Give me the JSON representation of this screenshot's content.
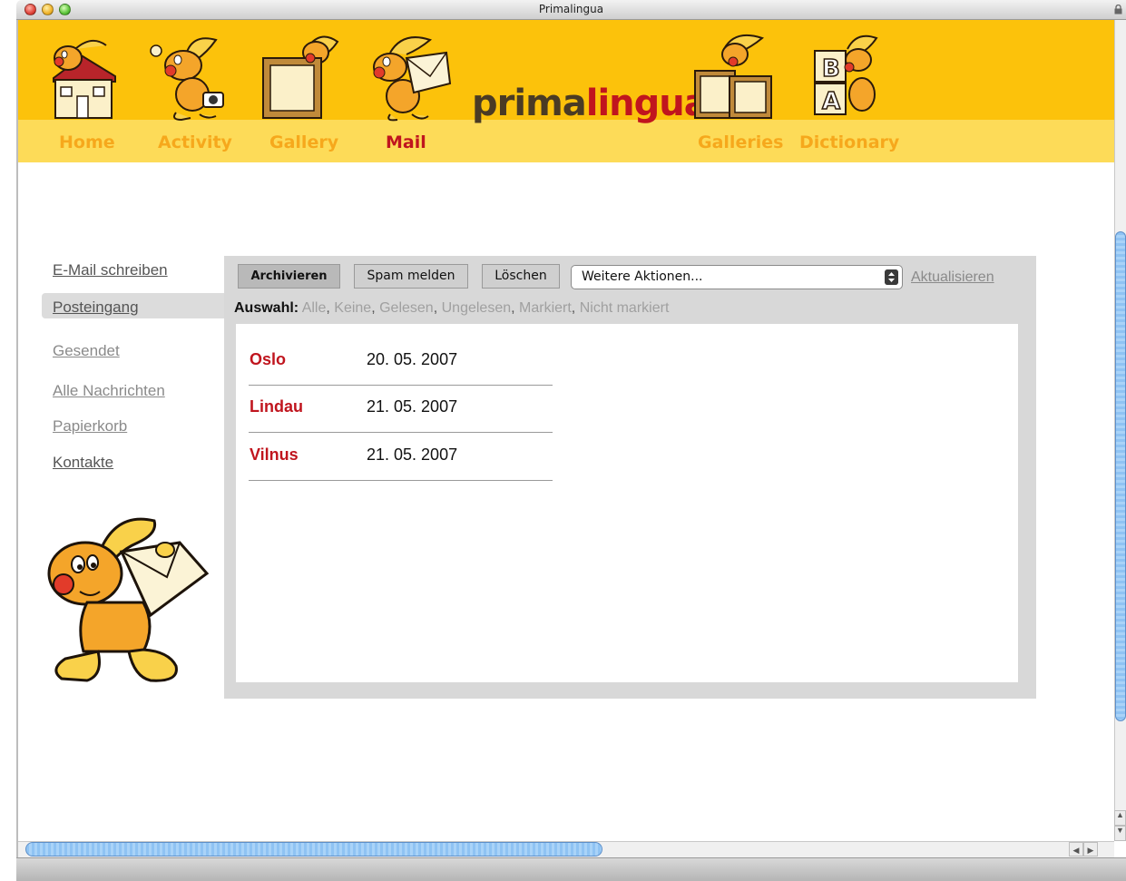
{
  "window": {
    "title": "Primalingua"
  },
  "nav": {
    "items": [
      {
        "label": "Home",
        "icon": "house-icon"
      },
      {
        "label": "Activity",
        "icon": "rabbit-camera-icon"
      },
      {
        "label": "Gallery",
        "icon": "picture-frame-icon"
      },
      {
        "label": "Mail",
        "icon": "rabbit-envelope-icon"
      },
      {
        "label": "Galleries",
        "icon": "frames-stack-icon"
      },
      {
        "label": "Dictionary",
        "icon": "letter-blocks-icon"
      }
    ],
    "active": "Mail"
  },
  "logo": {
    "part1": "prima",
    "part2": "lingua"
  },
  "sidebar": {
    "items": [
      {
        "label": "E-Mail schreiben"
      },
      {
        "label": "Posteingang"
      },
      {
        "label": "Gesendet"
      },
      {
        "label": "Alle Nachrichten"
      },
      {
        "label": "Papierkorb"
      },
      {
        "label": "Kontakte"
      }
    ]
  },
  "toolbar": {
    "archive": "Archivieren",
    "spam": "Spam melden",
    "delete": "Löschen",
    "more_actions": "Weitere Aktionen...",
    "refresh": "Aktualisieren"
  },
  "selection": {
    "label": "Auswahl:",
    "options": [
      "Alle",
      "Keine",
      "Gelesen",
      "Ungelesen",
      "Markiert",
      "Nicht markiert"
    ]
  },
  "messages": [
    {
      "from": "Oslo",
      "date": "20. 05. 2007"
    },
    {
      "from": "Lindau",
      "date": "21. 05. 2007"
    },
    {
      "from": "Vilnus",
      "date": "21. 05. 2007"
    }
  ],
  "colors": {
    "header": "#fcc20b",
    "accent": "#c0151e",
    "nav_inactive": "#f6a81c"
  }
}
